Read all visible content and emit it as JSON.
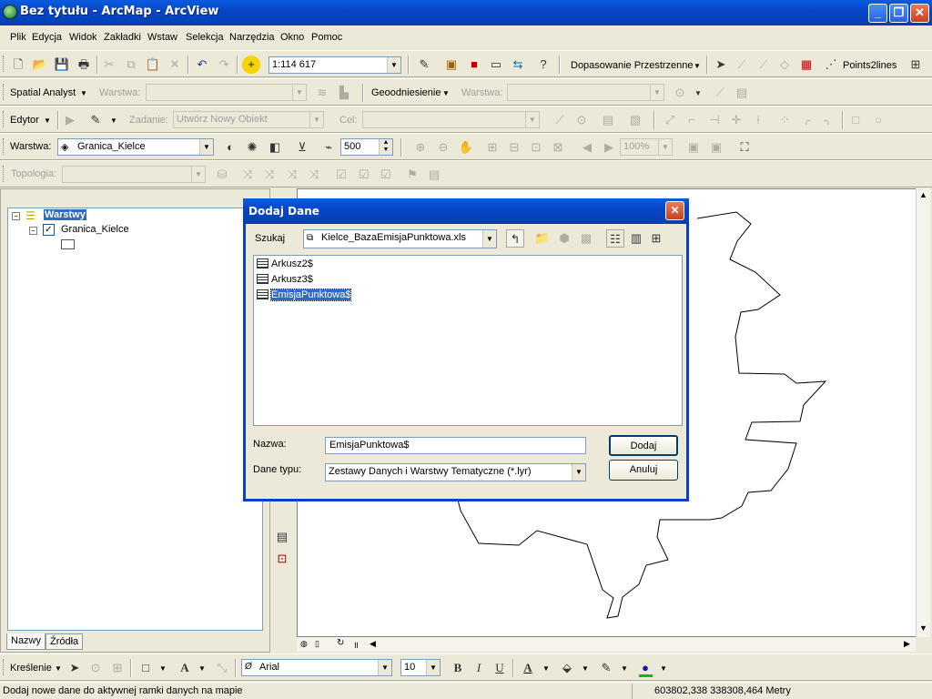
{
  "window": {
    "title": "Bez tytułu - ArcMap - ArcView",
    "minimize": "_",
    "restore": "❐",
    "close": "✕"
  },
  "menu": [
    "Plik",
    "Edycja",
    "Widok",
    "Zakładki",
    "Wstaw",
    "Selekcja",
    "Narzędzia",
    "Okno",
    "Pomoc"
  ],
  "standard_toolbar": {
    "scale": "1:114 617",
    "snapping_label": "Dopasowanie Przestrzenne",
    "points2lines": "Points2lines"
  },
  "toolbar2": {
    "spatial_analyst": "Spatial Analyst",
    "warstwa_label": "Warstwa:",
    "warstwa_value": "",
    "georef": "Geoodniesienie",
    "warstwa2_label": "Warstwa:",
    "warstwa2_value": ""
  },
  "editor_toolbar": {
    "editor": "Edytor",
    "zadanie_label": "Zadanie:",
    "zadanie_value": "Utwórz Nowy Obiekt",
    "cel_label": "Cel:",
    "cel_value": ""
  },
  "effects_toolbar": {
    "warstwa_label": "Warstwa:",
    "layer_value": "Granica_Kielce",
    "scale_value": "500",
    "zoom_value": "100%"
  },
  "topology_toolbar": {
    "label": "Topologia:",
    "value": ""
  },
  "toc": {
    "root": "Warstwy",
    "layer": "Granica_Kielce",
    "tabs": [
      "Nazwy",
      "Źródła"
    ]
  },
  "dialog": {
    "title": "Dodaj Dane",
    "close": "✕",
    "look_in_label": "Szukaj",
    "look_in_value": "Kielce_BazaEmisjaPunktowa.xls",
    "items": [
      "Arkusz2$",
      "Arkusz3$",
      "EmisjaPunktowa$"
    ],
    "selected_index": 2,
    "name_label": "Nazwa:",
    "name_value": "EmisjaPunktowa$",
    "type_label": "Dane typu:",
    "type_value": "Zestawy Danych i Warstwy Tematyczne (*.lyr)",
    "add_button": "Dodaj",
    "cancel_button": "Anuluj"
  },
  "drawing_toolbar": {
    "label": "Kreślenie",
    "font": "Arial",
    "size": "10",
    "bold": "B",
    "italic": "I",
    "underline": "U",
    "text_color": "A"
  },
  "status": {
    "message": "Dodaj nowe dane do aktywnej ramki danych na mapie",
    "coords": "603802,338  338308,464 Metry"
  },
  "colors": {
    "title_bar": "#0846c8",
    "selection": "#316ac5",
    "chrome": "#ece9d8"
  }
}
